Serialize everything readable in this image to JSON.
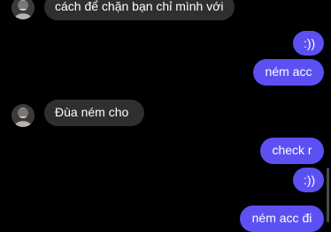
{
  "messages": [
    {
      "side": "incoming",
      "text": "cách để chặn bạn chỉ mình với",
      "avatar": "user-avatar"
    },
    {
      "side": "outgoing",
      "text": ":))"
    },
    {
      "side": "outgoing",
      "text": "ném acc"
    },
    {
      "side": "incoming",
      "text": "Đùa ném cho",
      "avatar": "user-avatar"
    },
    {
      "side": "outgoing",
      "text": "check r"
    },
    {
      "side": "outgoing",
      "text": ":))"
    },
    {
      "side": "outgoing",
      "text": "ném acc đi"
    }
  ],
  "colors": {
    "background": "#000000",
    "incoming_bubble": "#2f2f2f",
    "outgoing_bubble": "#5b51f2",
    "text": "#ffffff"
  }
}
